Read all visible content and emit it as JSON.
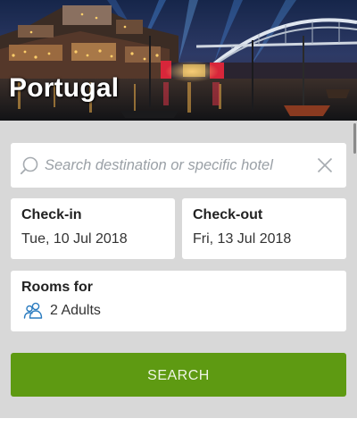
{
  "hero": {
    "title": "Portugal"
  },
  "search": {
    "placeholder": "Search destination or specific hotel"
  },
  "checkin": {
    "label": "Check-in",
    "date": "Tue, 10 Jul 2018"
  },
  "checkout": {
    "label": "Check-out",
    "date": "Fri, 13 Jul 2018"
  },
  "rooms": {
    "label": "Rooms for",
    "guests": "2 Adults",
    "icon": "guests-icon"
  },
  "actions": {
    "search_label": "SEARCH"
  },
  "colors": {
    "accent_green": "#5e9a12",
    "background": "#d8d8d8",
    "guests_icon": "#2a7bbf"
  }
}
